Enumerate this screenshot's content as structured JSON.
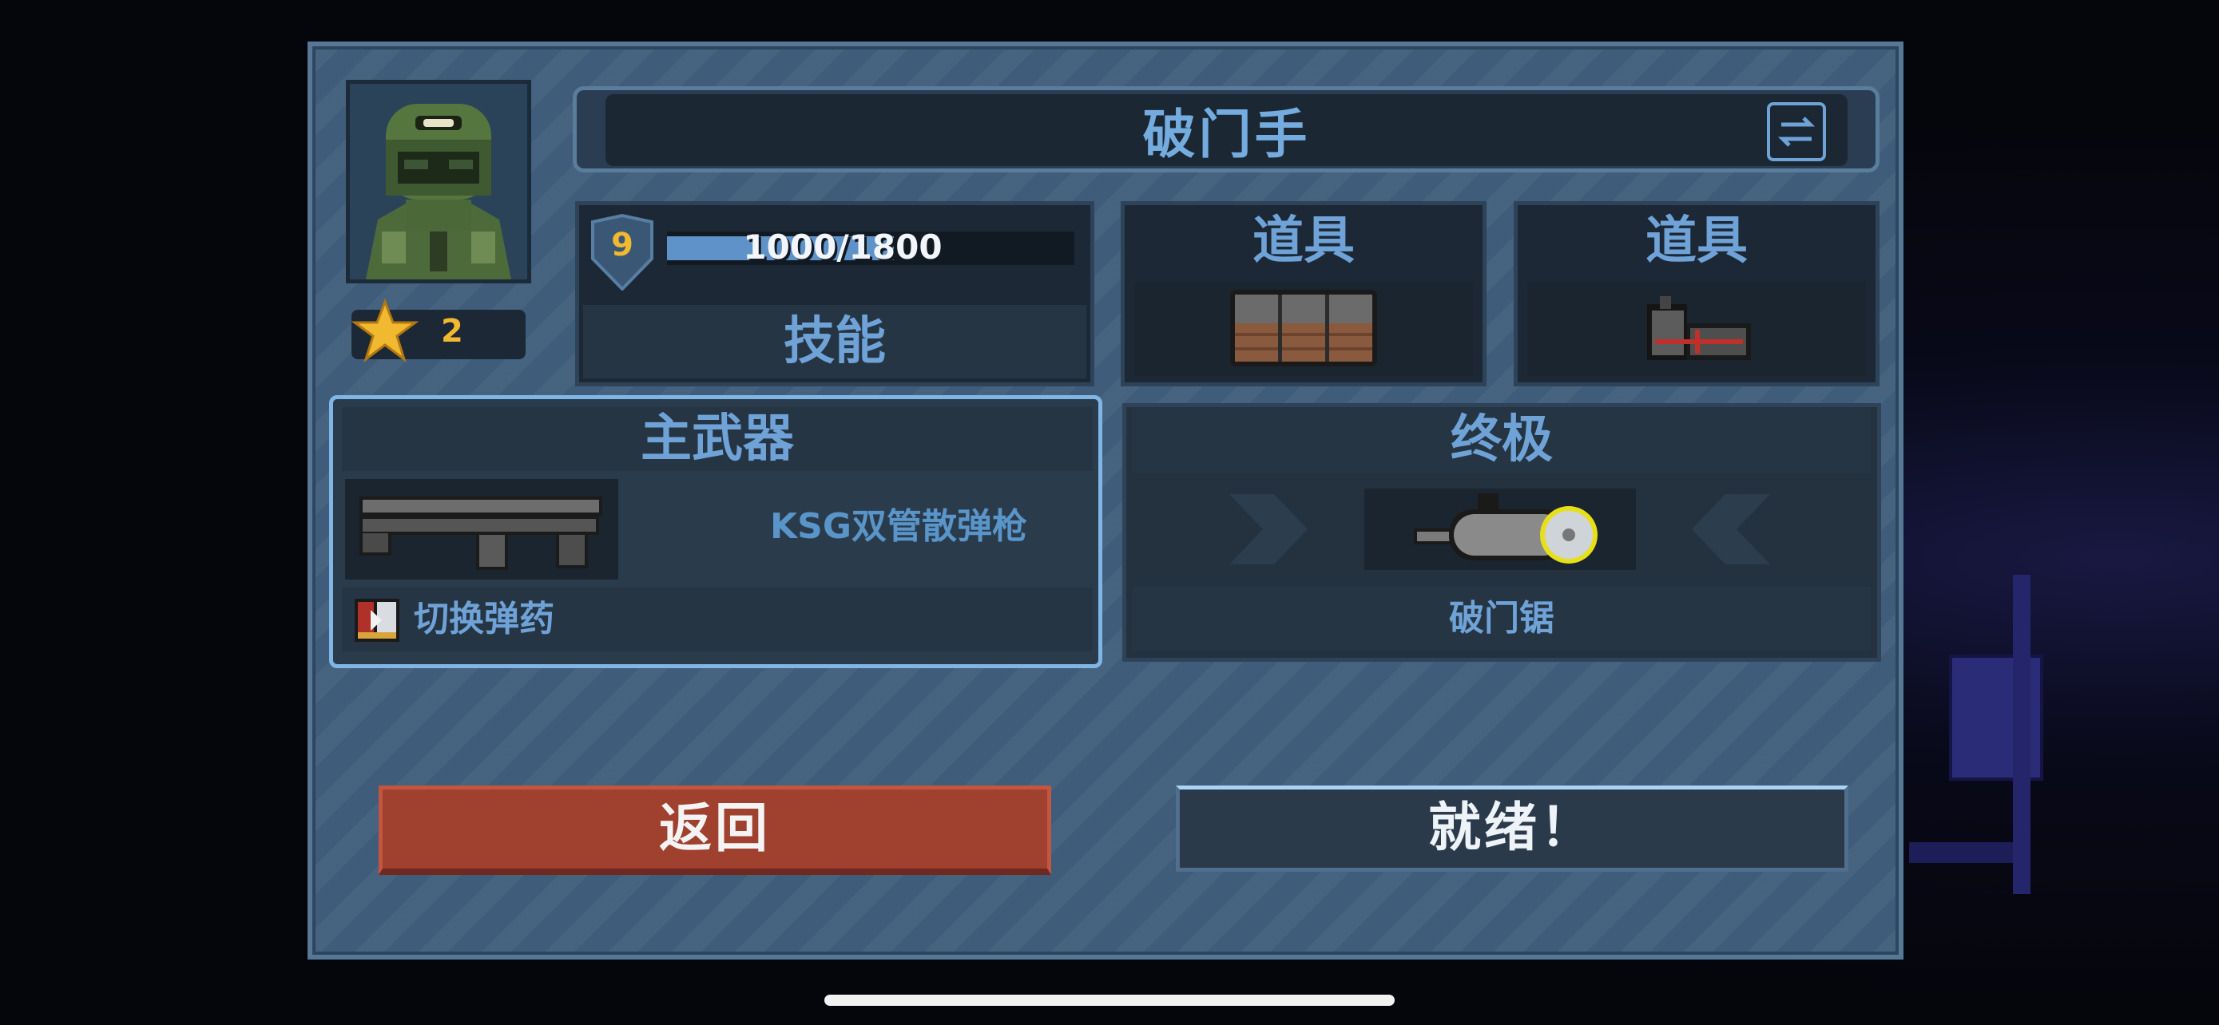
{
  "character": {
    "name": "破门手",
    "star_level": "2",
    "portrait_icon": "helmeted-soldier-portrait",
    "swap_icon": "swap-arrows-icon"
  },
  "skill": {
    "level": "9",
    "xp_text": "1000/1800",
    "xp_fraction": 0.556,
    "label": "技能"
  },
  "items": [
    {
      "title": "道具",
      "icon": "ammo-crates-icon"
    },
    {
      "title": "道具",
      "icon": "breaching-charge-icon"
    }
  ],
  "primary_weapon": {
    "header": "主武器",
    "name": "KSG双管散弹枪",
    "icon": "shotgun-icon",
    "ammo_action": "切换弹药",
    "ammo_icon": "ammo-switch-icon"
  },
  "ultimate": {
    "header": "终极",
    "name": "破门锯",
    "icon": "door-saw-icon"
  },
  "buttons": {
    "back": "返回",
    "ready": "就绪！"
  },
  "colors": {
    "panel": "#3f5d7a",
    "accent_text": "#6fa3d8",
    "level_gold": "#f1b930",
    "back_button": "#a0402f",
    "ready_highlight": "#a9d4f2"
  }
}
